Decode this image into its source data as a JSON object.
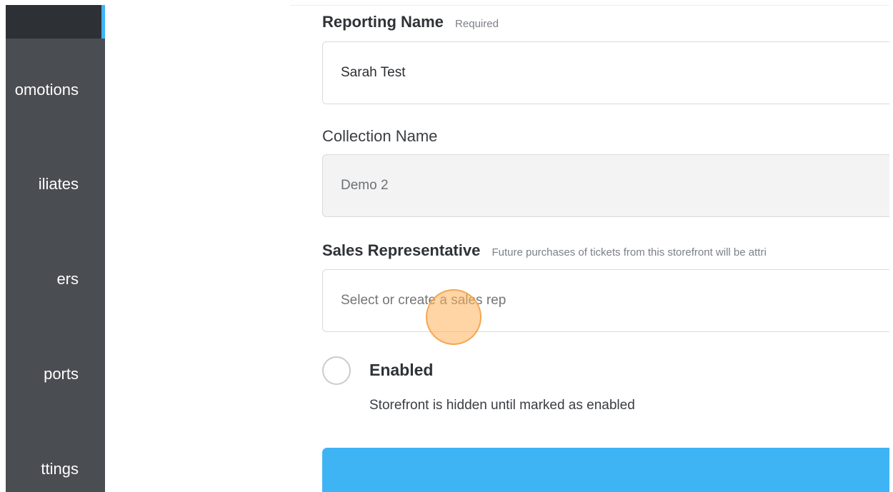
{
  "sidebar": {
    "items": [
      {
        "label": "omotions"
      },
      {
        "label": "iliates"
      },
      {
        "label": "ers"
      },
      {
        "label": "ports"
      },
      {
        "label": "ttings"
      }
    ]
  },
  "form": {
    "reporting_name": {
      "label": "Reporting Name",
      "hint": "Required",
      "value": "Sarah Test"
    },
    "collection_name": {
      "label": "Collection Name",
      "value": "Demo 2"
    },
    "sales_representative": {
      "label": "Sales Representative",
      "hint": "Future purchases of tickets from this storefront will be attri",
      "placeholder": "Select or create a sales rep"
    },
    "enabled": {
      "label": "Enabled",
      "description": "Storefront is hidden until marked as enabled"
    }
  },
  "colors": {
    "sidebar": "#4a4d52",
    "sidebar_active": "#2d3035",
    "accent": "#3fb4f5",
    "cursor_highlight": "#ffb35b"
  }
}
